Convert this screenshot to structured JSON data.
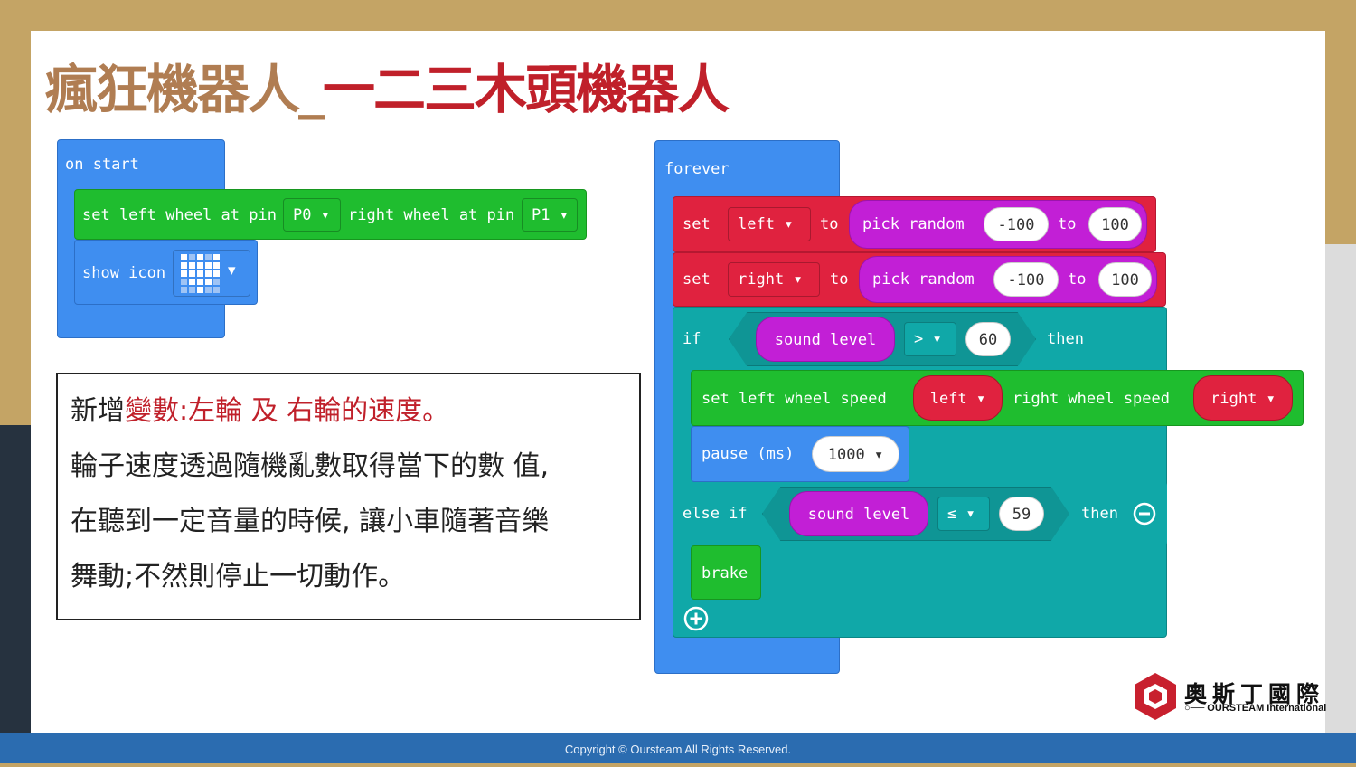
{
  "title": {
    "part1": "瘋狂機器人_",
    "part2": "一二三木頭機器人"
  },
  "on_start": {
    "header": "on start",
    "set_wheel": {
      "label1": "set left wheel at pin",
      "pin_left": "P0",
      "label2": "right wheel at pin",
      "pin_right": "P1"
    },
    "show_icon": {
      "label": "show icon",
      "icon": "heart-icon"
    }
  },
  "note": {
    "line1_prefix": "新增",
    "line1_highlight": "變數:左輪 及 右輪的速度。",
    "line2": "輪子速度透過隨機亂數取得當下的數 值,",
    "line3": "在聽到一定音量的時候, 讓小車隨著音樂",
    "line4": "舞動;不然則停止一切動作。"
  },
  "forever": {
    "header": "forever",
    "set_left": {
      "set": "set",
      "var": "left",
      "to": "to",
      "func": "pick random",
      "min": "-100",
      "to2": "to",
      "max": "100"
    },
    "set_right": {
      "set": "set",
      "var": "right",
      "to": "to",
      "func": "pick random",
      "min": "-100",
      "to2": "to",
      "max": "100"
    },
    "if_block": {
      "if": "if",
      "sensor": "sound level",
      "op": ">",
      "value": "60",
      "then": "then"
    },
    "set_speed": {
      "label1": "set left wheel speed",
      "left_var": "left",
      "label2": "right wheel speed",
      "right_var": "right"
    },
    "pause": {
      "label": "pause (ms)",
      "value": "1000"
    },
    "else_if": {
      "label": "else if",
      "sensor": "sound level",
      "op": "≤",
      "value": "59",
      "then": "then"
    },
    "brake": "brake"
  },
  "logo": {
    "name": "奧斯丁國際",
    "sub": "○── OURSTEAM International"
  },
  "footer": "Copyright © Oursteam All Rights Reserved.",
  "colors": {
    "blue": "#3f8ef0",
    "green": "#1fbd2f",
    "red": "#e0223f",
    "teal": "#10a8a8",
    "purple": "#c21fd6"
  }
}
